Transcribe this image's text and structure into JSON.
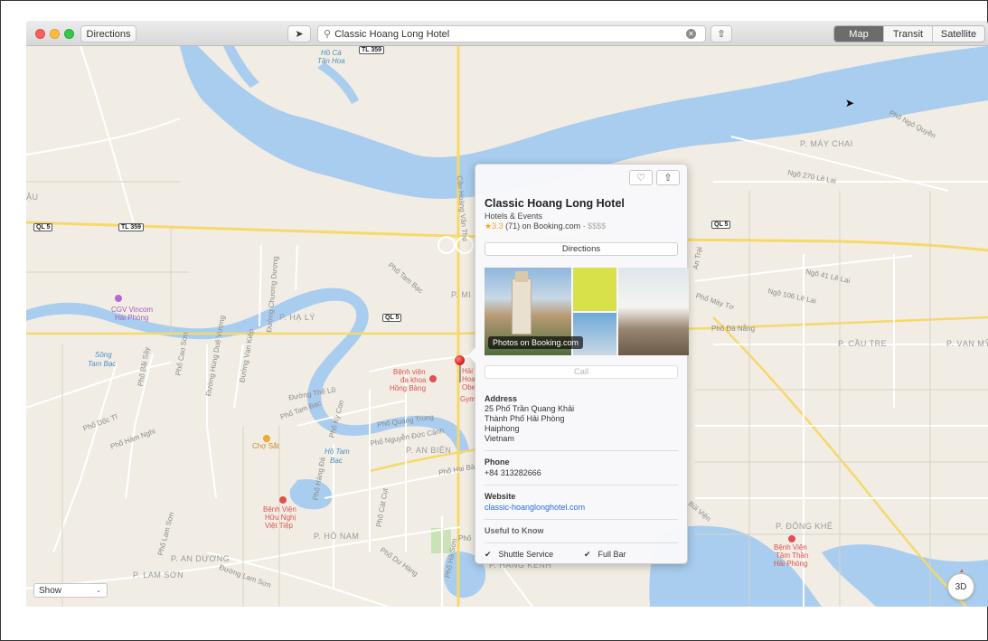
{
  "toolbar": {
    "directions_label": "Directions",
    "locate_icon": "location-arrow-icon",
    "search_value": "Classic Hoang Long Hotel",
    "map_modes": [
      "Map",
      "Transit",
      "Satellite"
    ],
    "active_mode": "Map"
  },
  "popover": {
    "title": "Classic Hoang Long Hotel",
    "category": "Hotels & Events",
    "rating_star": "★3.3",
    "rating_count": "(71) on Booking.com ·",
    "price": "$$$$",
    "directions_label": "Directions",
    "photos_caption": "Photos on Booking.com",
    "call_label": "Call",
    "address_heading": "Address",
    "address_lines": [
      "25 Phố Trần Quang Khải",
      "Thành Phố Hải Phòng",
      "Haiphong",
      "Vietnam"
    ],
    "phone_heading": "Phone",
    "phone": "+84 313282666",
    "website_heading": "Website",
    "website": "classic-hoanglonghotel.com",
    "useful_heading": "Useful to Know",
    "amenities": [
      "Shuttle Service",
      "Full Bar"
    ]
  },
  "map_labels": {
    "p_may_chai": "P. MÁY CHAI",
    "p_ha_ly": "P. HẠ LÝ",
    "p_cau_tre": "P. CẦU TRE",
    "p_van_my": "P. VẠN MỸ",
    "p_an_bien": "P. AN BIÊN",
    "p_ho_nam": "P. HỒ NAM",
    "p_an_duong": "P. AN DƯƠNG",
    "p_lam_son": "P. LAM SƠN",
    "p_hang_kenh": "P. HÀNG KÊNH",
    "p_dong_khe": "P. ĐÔNG KHÊ",
    "p_mi": "P. MI",
    "hau": "ẬU",
    "ho_ca": "Hồ Cá",
    "tam_hoa": "Tân Hoa",
    "song_tam_bac_1": "Sông",
    "song_tam_bac_2": "Tam Bạc",
    "cgv_1": "CGV Vincom",
    "cgv_2": "Hải Phòng",
    "benh_vien_1": "Bệnh viện",
    "benh_vien_2": "đa khoa",
    "benh_vien_3": "Hồng Bàng",
    "cho_sat": "Chợ Sắt",
    "ho_tam_bac_1": "Hồ Tam",
    "ho_tam_bac_2": "Bạc",
    "huu_nghi_1": "Bệnh Viện",
    "huu_nghi_2": "Hữu Nghị",
    "huu_nghi_3": "Việt Tiệp",
    "tam_than_1": "Bệnh Viện",
    "tam_than_2": "Tâm Thần",
    "tam_than_3": "Hải Phòng",
    "pho_ngo_quyen": "Phố Ngô Quyền",
    "ngo_270": "Ngõ 270 Lê Lai",
    "ngo_41": "Ngõ 41 Lê Lai",
    "ngo_106": "Ngõ 106 Lê Lai",
    "pho_may_to": "Phố Máy Tơ",
    "pho_da_nang": "Phố Đà Nẵng",
    "pho_quang_trung": "Phố Quang Trung",
    "pho_nguyen_duc_canh": "Phố Nguyễn Đức Cảnh",
    "pho_hai_ba": "Phố Hai Bà",
    "pho_hang_da": "Phố Hàng Đá",
    "pho_cat_cut": "Phố Cát Cụt",
    "pho_lam_son": "Phố Lam Sơn",
    "pho_tam_bac": "Phố Tam Bạc",
    "pho_bai_say": "Phố Bãi Sậy",
    "duong_hung_due_vuong": "Đường Hùng Duệ Vương",
    "duong_van_kiep": "Đường Vạn Kiếp",
    "duong_chuong_duong": "Đường Chương Dương",
    "cau_hoang_van_thu": "Cầu Hoàng Văn Thụ",
    "duong_the_le": "Đường Thế Lữ",
    "pho_tam_bac_2": "Phố Tam Bạc",
    "pho_hai_ba_2": "Phố Hai Bà",
    "duong_lam_son": "Đường Lam Sơn",
    "pho_ky_con": "Phố Kỳ Con",
    "pho_du_hang": "Phố Dư Hàng",
    "pho_ha_son": "Phố Hà Sơn",
    "pho_doc_ti": "Phố Dốc Tĩ",
    "pho_ham_nghi": "Phố Hàm Nghi",
    "pho_cao_son": "Phố Cao Sơn",
    "hal": "Hải",
    "hoa": "Hoa",
    "oxe": "Obe",
    "gym": "Gym",
    "pho_tr": "Phố",
    "an_trai": "An Trại",
    "bui_vien": "Bùi Viện"
  },
  "shields": [
    "TL 359",
    "QL 5",
    "TL 359",
    "QL 5",
    "QL 5"
  ],
  "controls": {
    "show_label": "Show",
    "compass_label": "3D",
    "zoom_out": "−",
    "zoom_in": "+"
  },
  "colors": {
    "water": "#a9cdee",
    "land": "#f1ede4",
    "road": "#ffffff",
    "major_road": "#f7d86a",
    "green": "#c9e3b6"
  }
}
